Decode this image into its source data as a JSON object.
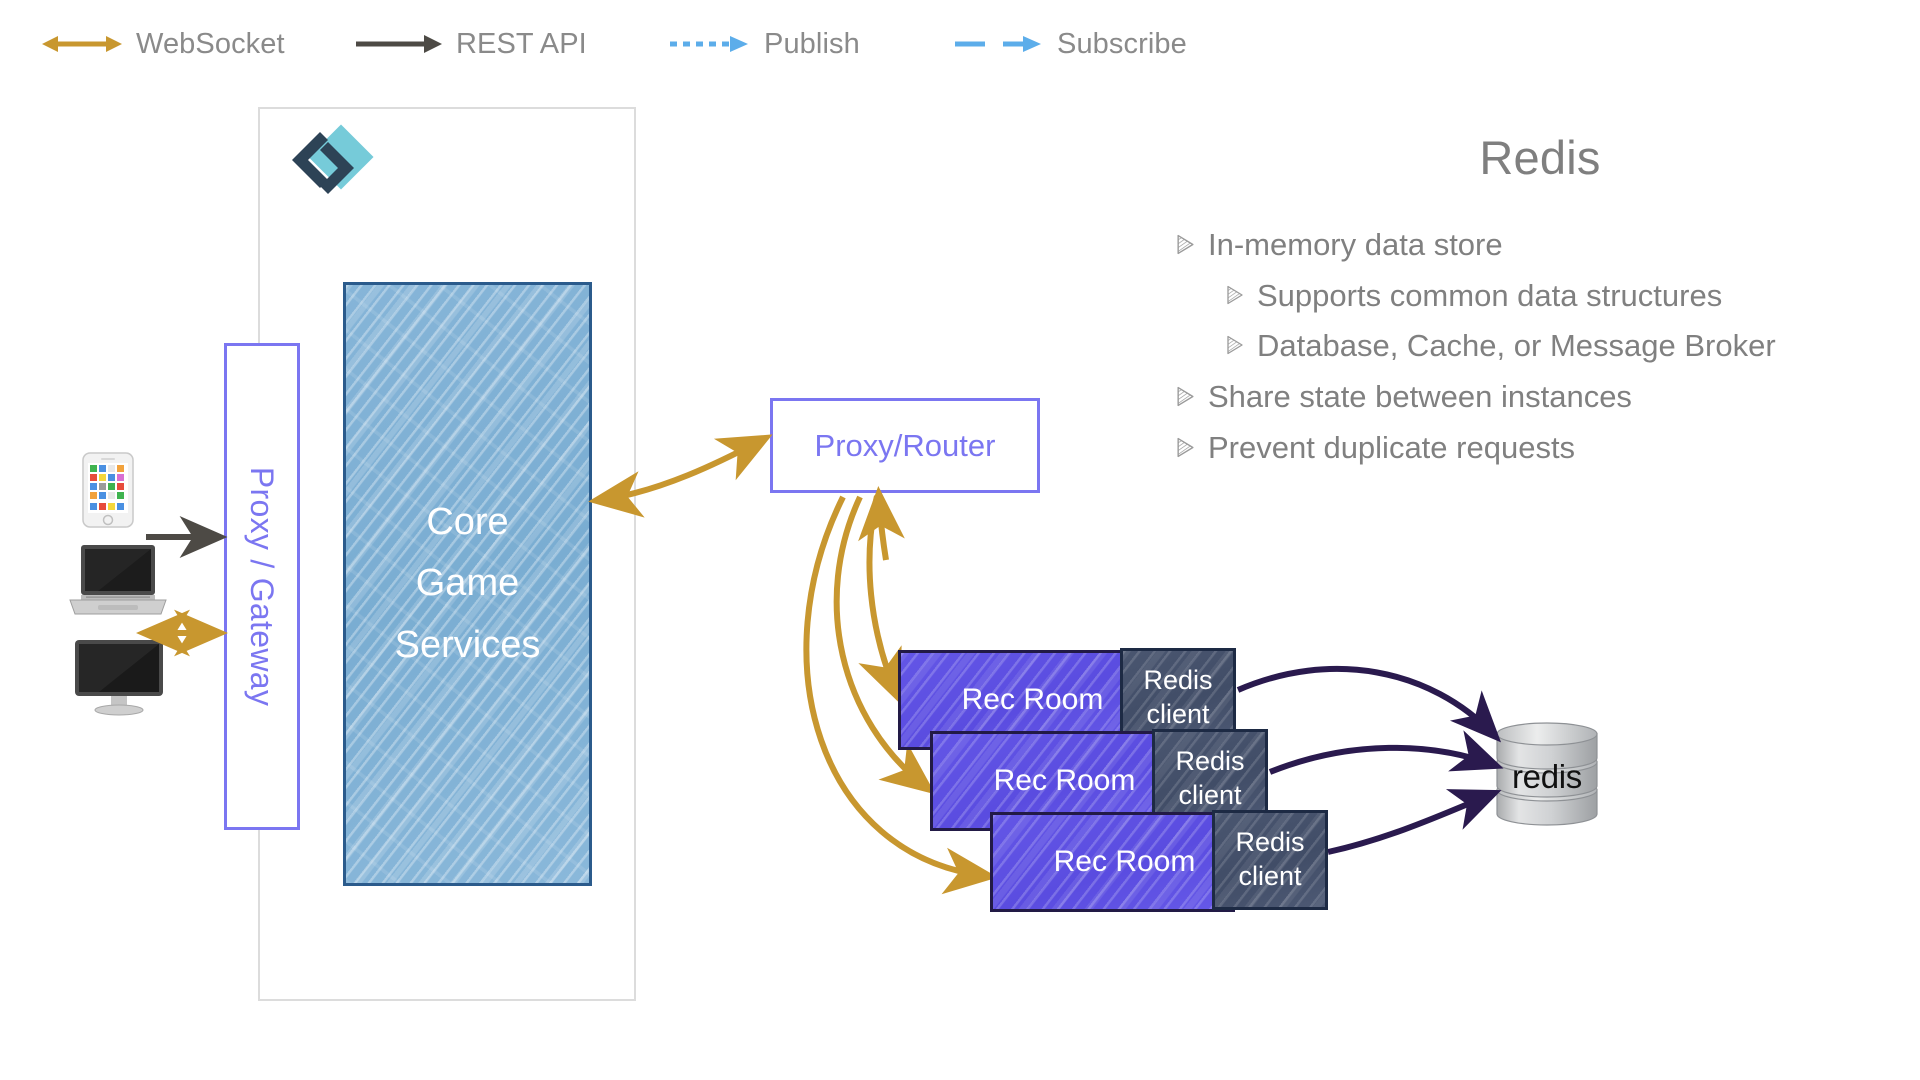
{
  "legend": {
    "items": [
      {
        "id": "websocket",
        "label": "WebSocket",
        "style": "double-arrow",
        "color": "#c8972f"
      },
      {
        "id": "rest-api",
        "label": "REST API",
        "style": "single-arrow",
        "color": "#4d4a45"
      },
      {
        "id": "publish",
        "label": "Publish",
        "style": "short-dashed-arrow",
        "color": "#5cadea"
      },
      {
        "id": "subscribe",
        "label": "Subscribe",
        "style": "long-dashed-arrow",
        "color": "#5cadea"
      }
    ]
  },
  "diagram": {
    "logo": {
      "name": "rec-room-logo",
      "diamond_color": "#76cbd9",
      "bracket_color": "#2d4356"
    },
    "proxy_gateway": {
      "label": "Proxy / Gateway",
      "border_color": "#7b76f1",
      "text_color": "#7b76f1"
    },
    "core_game_services": {
      "lines": [
        "Core",
        "Game",
        "Services"
      ],
      "fill_color": "#7fb0d4",
      "border_color": "#2b5b8c",
      "text_color": "#ffffff"
    },
    "proxy_router": {
      "label": "Proxy/Router",
      "border_color": "#7b76f1",
      "text_color": "#7b76f1"
    },
    "rec_rooms": [
      {
        "label": "Rec Room",
        "client_lines": [
          "Redis",
          "client"
        ]
      },
      {
        "label": "Rec Room",
        "client_lines": [
          "Redis",
          "client"
        ]
      },
      {
        "label": "Rec Room",
        "client_lines": [
          "Redis",
          "client"
        ]
      }
    ],
    "rec_room_fill": "#5b4de0",
    "redis_client_fill": "#44506a",
    "redis_store": {
      "label": "redis",
      "shape": "cylinder",
      "color": "#c9cbcd"
    },
    "devices": [
      {
        "name": "smartphone"
      },
      {
        "name": "laptop"
      },
      {
        "name": "desktop-monitor"
      }
    ],
    "edge_colors": {
      "websocket": "#c8972f",
      "rest_api": "#4d4a45",
      "redis_link": "#2a1a4e"
    }
  },
  "right_panel": {
    "title": "Redis",
    "bullets": [
      {
        "level": 0,
        "text": "In-memory data store"
      },
      {
        "level": 1,
        "text": "Supports common data structures"
      },
      {
        "level": 1,
        "text": "Database, Cache, or Message Broker"
      },
      {
        "level": 0,
        "text": "Share state between instances"
      },
      {
        "level": 0,
        "text": "Prevent duplicate requests"
      }
    ],
    "title_color": "#7f7f7f",
    "text_color": "#808080"
  }
}
